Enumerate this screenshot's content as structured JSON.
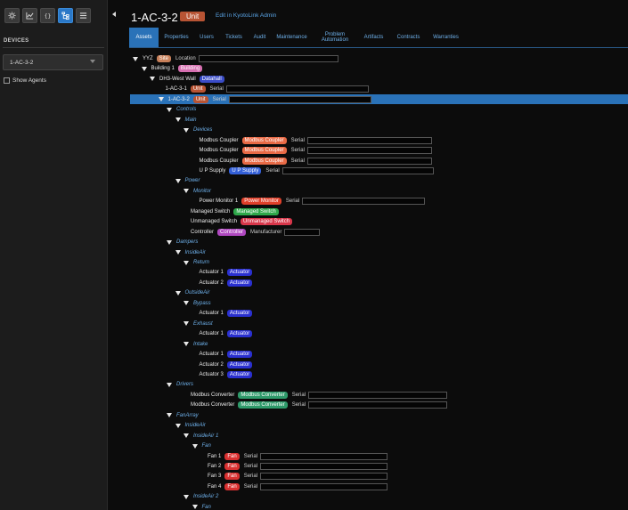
{
  "colors": {
    "site": "#c8805a",
    "building": "#d66fb0",
    "datahall": "#3a4cc8",
    "unit": "#b85434",
    "modbus_coupler": "#e86a46",
    "ups": "#3460d8",
    "power_monitor": "#e0402a",
    "managed_switch": "#2ea84a",
    "unmanaged_switch": "#d8364a",
    "controller": "#b048c0",
    "actuator": "#2a30d0",
    "modbus_converter": "#2e9a6a",
    "fan": "#d83030"
  },
  "sidebar": {
    "tools": [
      {
        "icon": "gear-icon",
        "active": false
      },
      {
        "icon": "chart-icon",
        "active": false
      },
      {
        "icon": "braces-icon",
        "active": false
      },
      {
        "icon": "hierarchy-icon",
        "active": true
      },
      {
        "icon": "list-icon",
        "active": false
      }
    ],
    "devices_label": "DEVICES",
    "selected_device": "1-AC-3-2",
    "show_agents_label": "Show Agents"
  },
  "header": {
    "title": "1-AC-3-2",
    "type": "Unit",
    "edit_link": "Edit in KyotoLink Admin"
  },
  "tabs": [
    {
      "label": "Assets",
      "active": true
    },
    {
      "label": "Properties",
      "active": false
    },
    {
      "label": "Users",
      "active": false
    },
    {
      "label": "Tickets",
      "active": false
    },
    {
      "label": "Audit",
      "active": false
    },
    {
      "label": "Maintenance",
      "active": false
    },
    {
      "label": "Problem Automation",
      "active": false
    },
    {
      "label": "Artifacts",
      "active": false
    },
    {
      "label": "Contracts",
      "active": false
    },
    {
      "label": "Warranties",
      "active": false
    }
  ],
  "tree": [
    {
      "d": 0,
      "caret": true,
      "name": "YYZ",
      "badge": "Site",
      "color": "site",
      "field": "Location"
    },
    {
      "d": 1,
      "caret": true,
      "name": "Building 1",
      "badge": "Building",
      "color": "building"
    },
    {
      "d": 2,
      "caret": true,
      "name": "DH3-West Wall",
      "badge": "Datahall",
      "color": "datahall"
    },
    {
      "d": 3,
      "caret": false,
      "name": "1-AC-3-1",
      "badge": "Unit",
      "color": "unit",
      "field": "Serial"
    },
    {
      "d": 3,
      "caret": true,
      "name": "1-AC-3-2",
      "badge": "Unit",
      "color": "unit",
      "field": "Serial",
      "selected": true
    },
    {
      "d": 4,
      "caret": true,
      "name": "Controls",
      "group": true
    },
    {
      "d": 5,
      "caret": true,
      "name": "Main",
      "group": true
    },
    {
      "d": 6,
      "caret": true,
      "name": "Devices",
      "group": true
    },
    {
      "d": 7,
      "caret": false,
      "name": "Modbus Coupler",
      "badge": "Modbus Coupler",
      "color": "modbus_coupler",
      "field": "Serial"
    },
    {
      "d": 7,
      "caret": false,
      "name": "Modbus Coupler",
      "badge": "Modbus Coupler",
      "color": "modbus_coupler",
      "field": "Serial"
    },
    {
      "d": 7,
      "caret": false,
      "name": "Modbus Coupler",
      "badge": "Modbus Coupler",
      "color": "modbus_coupler",
      "field": "Serial"
    },
    {
      "d": 7,
      "caret": false,
      "name": "U P Supply",
      "badge": "U P Supply",
      "color": "ups",
      "field": "Serial"
    },
    {
      "d": 5,
      "caret": true,
      "name": "Power",
      "group": true
    },
    {
      "d": 6,
      "caret": true,
      "name": "Monitor",
      "group": true
    },
    {
      "d": 7,
      "caret": false,
      "name": "Power Monitor 1",
      "badge": "Power Monitor",
      "color": "power_monitor",
      "field": "Serial"
    },
    {
      "d": 6,
      "caret": false,
      "name": "Managed Switch",
      "badge": "Managed Switch",
      "color": "managed_switch"
    },
    {
      "d": 6,
      "caret": false,
      "name": "Unmanaged Switch",
      "badge": "Unmanaged Switch",
      "color": "unmanaged_switch"
    },
    {
      "d": 6,
      "caret": false,
      "name": "Controller",
      "badge": "Controller",
      "color": "controller",
      "field": "Manufacturer"
    },
    {
      "d": 4,
      "caret": true,
      "name": "Dampers",
      "group": true
    },
    {
      "d": 5,
      "caret": true,
      "name": "InsideAir",
      "group": true
    },
    {
      "d": 6,
      "caret": true,
      "name": "Return",
      "group": true
    },
    {
      "d": 7,
      "caret": false,
      "name": "Actuator 1",
      "badge": "Actuator",
      "color": "actuator"
    },
    {
      "d": 7,
      "caret": false,
      "name": "Actuator 2",
      "badge": "Actuator",
      "color": "actuator"
    },
    {
      "d": 5,
      "caret": true,
      "name": "OutsideAir",
      "group": true
    },
    {
      "d": 6,
      "caret": true,
      "name": "Bypass",
      "group": true
    },
    {
      "d": 7,
      "caret": false,
      "name": "Actuator 1",
      "badge": "Actuator",
      "color": "actuator"
    },
    {
      "d": 6,
      "caret": true,
      "name": "Exhaust",
      "group": true
    },
    {
      "d": 7,
      "caret": false,
      "name": "Actuator 1",
      "badge": "Actuator",
      "color": "actuator"
    },
    {
      "d": 6,
      "caret": true,
      "name": "Intake",
      "group": true
    },
    {
      "d": 7,
      "caret": false,
      "name": "Actuator 1",
      "badge": "Actuator",
      "color": "actuator"
    },
    {
      "d": 7,
      "caret": false,
      "name": "Actuator 2",
      "badge": "Actuator",
      "color": "actuator"
    },
    {
      "d": 7,
      "caret": false,
      "name": "Actuator 3",
      "badge": "Actuator",
      "color": "actuator"
    },
    {
      "d": 4,
      "caret": true,
      "name": "Drivers",
      "group": true
    },
    {
      "d": 6,
      "caret": false,
      "name": "Modbus Converter",
      "badge": "Modbus Converter",
      "color": "modbus_converter",
      "field": "Serial"
    },
    {
      "d": 6,
      "caret": false,
      "name": "Modbus Converter",
      "badge": "Modbus Converter",
      "color": "modbus_converter",
      "field": "Serial"
    },
    {
      "d": 4,
      "caret": true,
      "name": "FanArray",
      "group": true
    },
    {
      "d": 5,
      "caret": true,
      "name": "InsideAir",
      "group": true
    },
    {
      "d": 6,
      "caret": true,
      "name": "InsideAir 1",
      "group": true
    },
    {
      "d": 7,
      "caret": true,
      "name": "Fan",
      "group": true
    },
    {
      "d": 8,
      "caret": false,
      "name": "Fan 1",
      "badge": "Fan",
      "color": "fan",
      "field": "Serial"
    },
    {
      "d": 8,
      "caret": false,
      "name": "Fan 2",
      "badge": "Fan",
      "color": "fan",
      "field": "Serial"
    },
    {
      "d": 8,
      "caret": false,
      "name": "Fan 3",
      "badge": "Fan",
      "color": "fan",
      "field": "Serial"
    },
    {
      "d": 8,
      "caret": false,
      "name": "Fan 4",
      "badge": "Fan",
      "color": "fan",
      "field": "Serial"
    },
    {
      "d": 6,
      "caret": true,
      "name": "InsideAir 2",
      "group": true
    },
    {
      "d": 7,
      "caret": true,
      "name": "Fan",
      "group": true
    }
  ]
}
